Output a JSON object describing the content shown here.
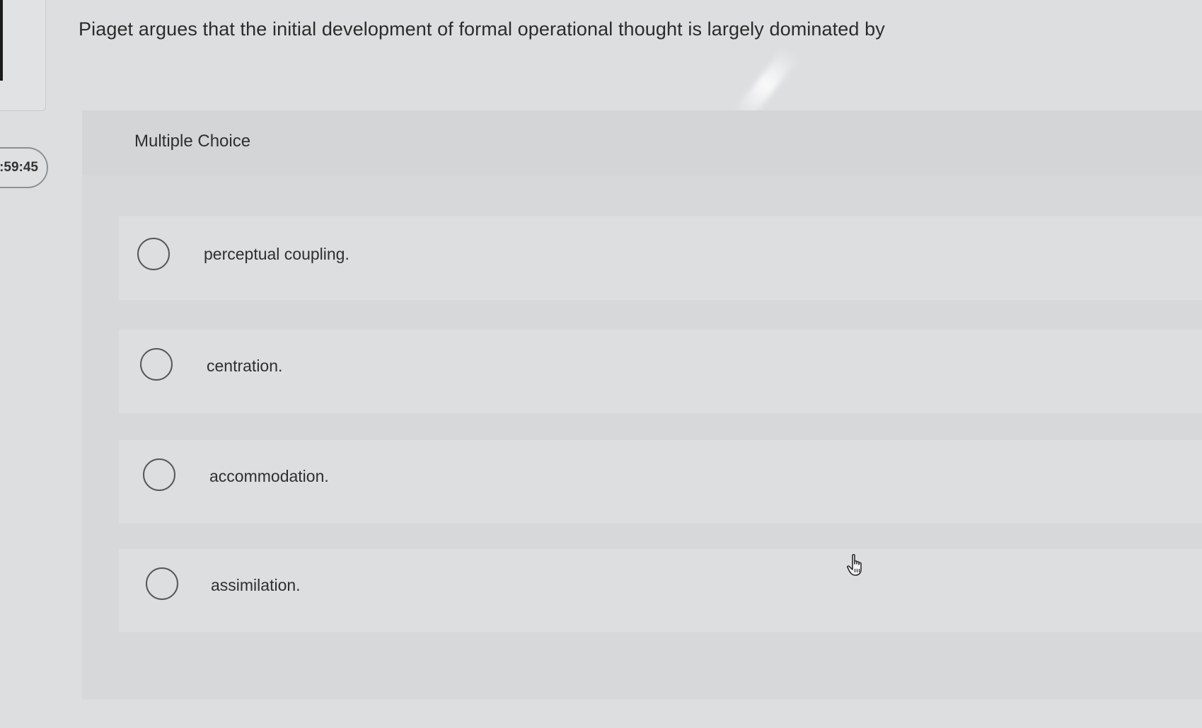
{
  "timer": {
    "text": ":59:45"
  },
  "question": {
    "text": "Piaget argues that the initial development of formal operational thought is largely dominated by"
  },
  "panel": {
    "type_label": "Multiple Choice"
  },
  "options": [
    {
      "label": "perceptual coupling."
    },
    {
      "label": "centration."
    },
    {
      "label": "accommodation."
    },
    {
      "label": "assimilation."
    }
  ],
  "cursor": {
    "icon": "hand-pointer-icon"
  }
}
